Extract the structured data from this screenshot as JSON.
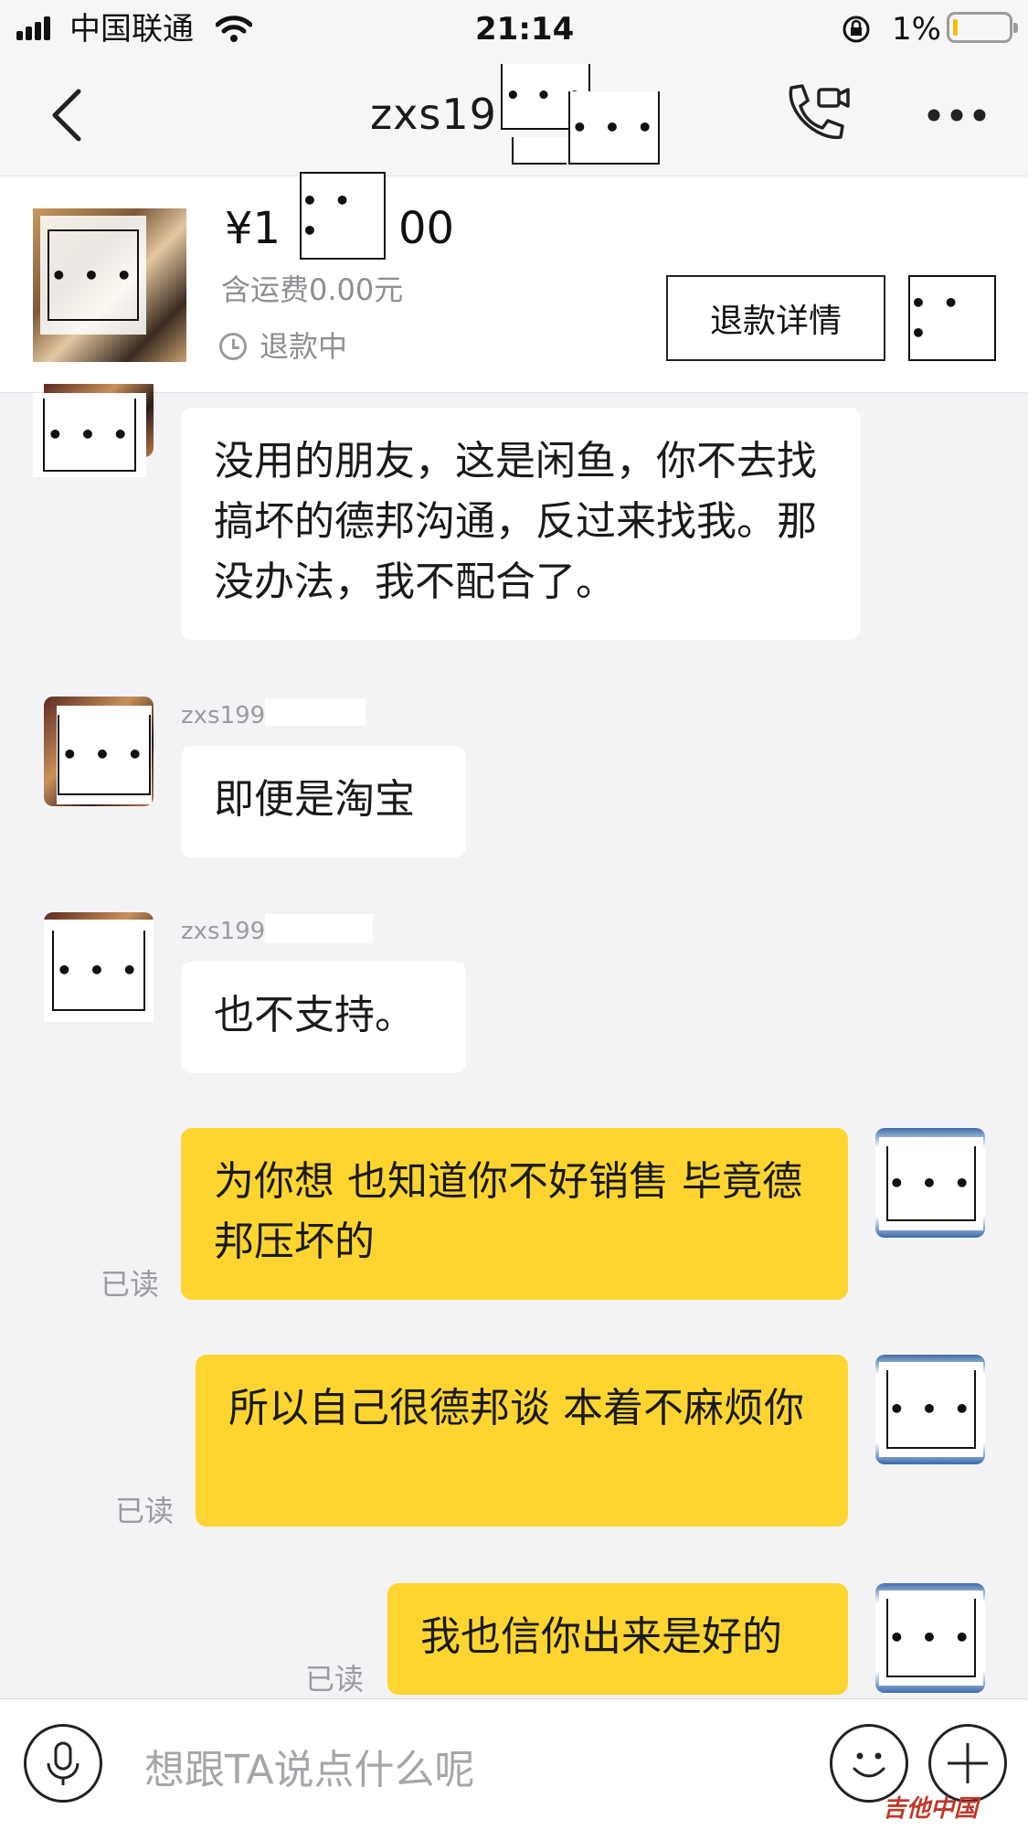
{
  "status_bar": {
    "carrier": "中国联通",
    "time": "21:14",
    "battery": "1%"
  },
  "nav": {
    "title": "zxs19"
  },
  "order": {
    "price_prefix": "¥1",
    "price_suffix": "00",
    "shipping": "含运费0.00元",
    "status": "退款中",
    "refund_button": "退款详情"
  },
  "redacted": "• • •",
  "messages": [
    {
      "from": "other",
      "sender": "",
      "text": "没用的朋友，这是闲鱼，你不去找搞坏的德邦沟通，反过来找我。那没办法，我不配合了。"
    },
    {
      "from": "other",
      "sender": "zxs199",
      "text": "即便是淘宝"
    },
    {
      "from": "other",
      "sender": "zxs199",
      "text": "也不支持。"
    },
    {
      "from": "self",
      "status": "已读",
      "text": "为你想 也知道你不好销售 毕竟德邦压坏的"
    },
    {
      "from": "self",
      "status": "已读",
      "text": "所以自己很德邦谈 本着不麻烦你"
    },
    {
      "from": "self",
      "status": "已读",
      "text": "我也信你出来是好的"
    }
  ],
  "input": {
    "placeholder": "想跟TA说点什么呢"
  },
  "watermark": "吉他中国"
}
